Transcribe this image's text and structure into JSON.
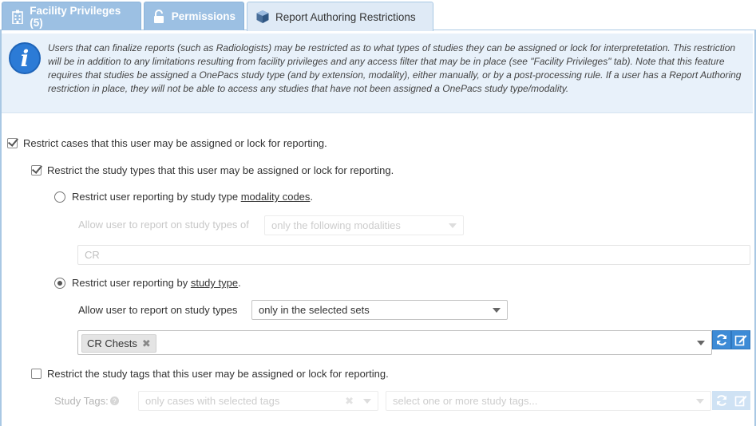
{
  "tabs": [
    {
      "label": "Facility Privileges (5)",
      "icon": "hospital-icon"
    },
    {
      "label": "Permissions",
      "icon": "unlock-icon"
    },
    {
      "label": "Report Authoring Restrictions",
      "icon": "cube-icon"
    }
  ],
  "info": {
    "icon": "info-icon",
    "text": "Users that can finalize reports (such as Radiologists) may be restricted as to what types of studies they can be assigned or lock for interpretetation. This restriction will be in addition to any limitations resulting from facility privileges and any access filter that may be in place (see \"Facility Privileges\" tab). Note that this feature requires that studies be assigned a OnePacs study type (and by extension, modality), either manually, or by a post-processing rule. If a user has a Report Authoring restriction in place, they will not be able to access any studies that have not been assigned a OnePacs study type/modality."
  },
  "restrict_cases": {
    "label": "Restrict cases that this user may be assigned or lock for reporting.",
    "checked": true
  },
  "restrict_types": {
    "label": "Restrict the study types that this user may be assigned or lock for reporting.",
    "checked": true
  },
  "by_modality": {
    "prefix": "Restrict user reporting by study type ",
    "link": "modality codes",
    "suffix": ".",
    "selected": false,
    "allow_label": "Allow user to report on study types of",
    "select_value": "only the following modalities",
    "codes_value": "CR"
  },
  "by_study_type": {
    "prefix": "Restrict user reporting by ",
    "link": "study type",
    "suffix": ".",
    "selected": true,
    "allow_label": "Allow user to report on study types",
    "select_value": "only in the selected sets",
    "tags": [
      "CR Chests"
    ]
  },
  "restrict_tags": {
    "label": "Restrict the study tags that this user may be assigned or lock for reporting.",
    "checked": false,
    "study_tags_label": "Study Tags:",
    "filter_value": "only cases with selected tags",
    "tags_placeholder": "select one or more study tags..."
  },
  "colors": {
    "accent": "#3d8bd6",
    "tab_inactive": "#9cc0e3",
    "tab_active": "#dfeaf6",
    "info_bg": "#e8f1fa"
  }
}
